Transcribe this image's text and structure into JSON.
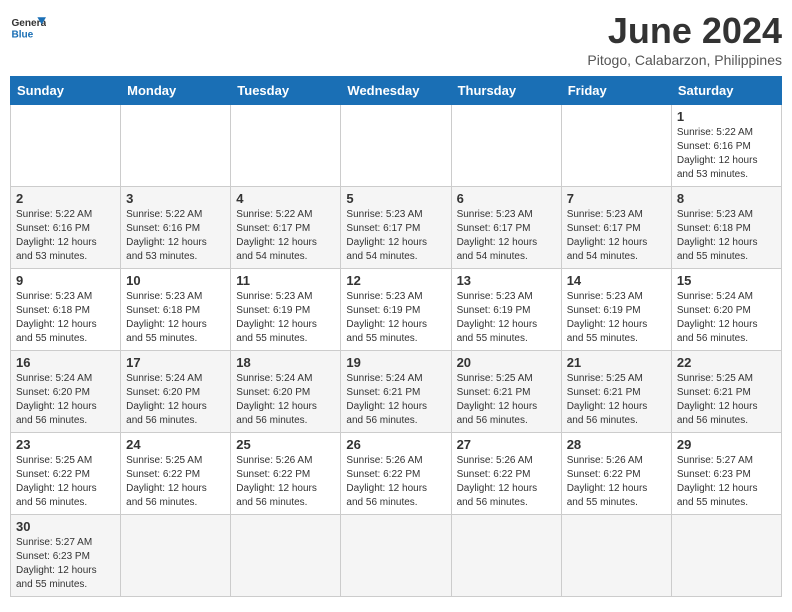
{
  "header": {
    "logo_text_general": "General",
    "logo_text_blue": "Blue",
    "month_title": "June 2024",
    "subtitle": "Pitogo, Calabarzon, Philippines"
  },
  "days_of_week": [
    "Sunday",
    "Monday",
    "Tuesday",
    "Wednesday",
    "Thursday",
    "Friday",
    "Saturday"
  ],
  "weeks": [
    {
      "shaded": false,
      "days": [
        {
          "number": "",
          "info": ""
        },
        {
          "number": "",
          "info": ""
        },
        {
          "number": "",
          "info": ""
        },
        {
          "number": "",
          "info": ""
        },
        {
          "number": "",
          "info": ""
        },
        {
          "number": "",
          "info": ""
        },
        {
          "number": "1",
          "info": "Sunrise: 5:22 AM\nSunset: 6:16 PM\nDaylight: 12 hours\nand 53 minutes."
        }
      ]
    },
    {
      "shaded": true,
      "days": [
        {
          "number": "2",
          "info": "Sunrise: 5:22 AM\nSunset: 6:16 PM\nDaylight: 12 hours\nand 53 minutes."
        },
        {
          "number": "3",
          "info": "Sunrise: 5:22 AM\nSunset: 6:16 PM\nDaylight: 12 hours\nand 53 minutes."
        },
        {
          "number": "4",
          "info": "Sunrise: 5:22 AM\nSunset: 6:17 PM\nDaylight: 12 hours\nand 54 minutes."
        },
        {
          "number": "5",
          "info": "Sunrise: 5:23 AM\nSunset: 6:17 PM\nDaylight: 12 hours\nand 54 minutes."
        },
        {
          "number": "6",
          "info": "Sunrise: 5:23 AM\nSunset: 6:17 PM\nDaylight: 12 hours\nand 54 minutes."
        },
        {
          "number": "7",
          "info": "Sunrise: 5:23 AM\nSunset: 6:17 PM\nDaylight: 12 hours\nand 54 minutes."
        },
        {
          "number": "8",
          "info": "Sunrise: 5:23 AM\nSunset: 6:18 PM\nDaylight: 12 hours\nand 55 minutes."
        }
      ]
    },
    {
      "shaded": false,
      "days": [
        {
          "number": "9",
          "info": "Sunrise: 5:23 AM\nSunset: 6:18 PM\nDaylight: 12 hours\nand 55 minutes."
        },
        {
          "number": "10",
          "info": "Sunrise: 5:23 AM\nSunset: 6:18 PM\nDaylight: 12 hours\nand 55 minutes."
        },
        {
          "number": "11",
          "info": "Sunrise: 5:23 AM\nSunset: 6:19 PM\nDaylight: 12 hours\nand 55 minutes."
        },
        {
          "number": "12",
          "info": "Sunrise: 5:23 AM\nSunset: 6:19 PM\nDaylight: 12 hours\nand 55 minutes."
        },
        {
          "number": "13",
          "info": "Sunrise: 5:23 AM\nSunset: 6:19 PM\nDaylight: 12 hours\nand 55 minutes."
        },
        {
          "number": "14",
          "info": "Sunrise: 5:23 AM\nSunset: 6:19 PM\nDaylight: 12 hours\nand 55 minutes."
        },
        {
          "number": "15",
          "info": "Sunrise: 5:24 AM\nSunset: 6:20 PM\nDaylight: 12 hours\nand 56 minutes."
        }
      ]
    },
    {
      "shaded": true,
      "days": [
        {
          "number": "16",
          "info": "Sunrise: 5:24 AM\nSunset: 6:20 PM\nDaylight: 12 hours\nand 56 minutes."
        },
        {
          "number": "17",
          "info": "Sunrise: 5:24 AM\nSunset: 6:20 PM\nDaylight: 12 hours\nand 56 minutes."
        },
        {
          "number": "18",
          "info": "Sunrise: 5:24 AM\nSunset: 6:20 PM\nDaylight: 12 hours\nand 56 minutes."
        },
        {
          "number": "19",
          "info": "Sunrise: 5:24 AM\nSunset: 6:21 PM\nDaylight: 12 hours\nand 56 minutes."
        },
        {
          "number": "20",
          "info": "Sunrise: 5:25 AM\nSunset: 6:21 PM\nDaylight: 12 hours\nand 56 minutes."
        },
        {
          "number": "21",
          "info": "Sunrise: 5:25 AM\nSunset: 6:21 PM\nDaylight: 12 hours\nand 56 minutes."
        },
        {
          "number": "22",
          "info": "Sunrise: 5:25 AM\nSunset: 6:21 PM\nDaylight: 12 hours\nand 56 minutes."
        }
      ]
    },
    {
      "shaded": false,
      "days": [
        {
          "number": "23",
          "info": "Sunrise: 5:25 AM\nSunset: 6:22 PM\nDaylight: 12 hours\nand 56 minutes."
        },
        {
          "number": "24",
          "info": "Sunrise: 5:25 AM\nSunset: 6:22 PM\nDaylight: 12 hours\nand 56 minutes."
        },
        {
          "number": "25",
          "info": "Sunrise: 5:26 AM\nSunset: 6:22 PM\nDaylight: 12 hours\nand 56 minutes."
        },
        {
          "number": "26",
          "info": "Sunrise: 5:26 AM\nSunset: 6:22 PM\nDaylight: 12 hours\nand 56 minutes."
        },
        {
          "number": "27",
          "info": "Sunrise: 5:26 AM\nSunset: 6:22 PM\nDaylight: 12 hours\nand 56 minutes."
        },
        {
          "number": "28",
          "info": "Sunrise: 5:26 AM\nSunset: 6:22 PM\nDaylight: 12 hours\nand 55 minutes."
        },
        {
          "number": "29",
          "info": "Sunrise: 5:27 AM\nSunset: 6:23 PM\nDaylight: 12 hours\nand 55 minutes."
        }
      ]
    },
    {
      "shaded": true,
      "days": [
        {
          "number": "30",
          "info": "Sunrise: 5:27 AM\nSunset: 6:23 PM\nDaylight: 12 hours\nand 55 minutes."
        },
        {
          "number": "",
          "info": ""
        },
        {
          "number": "",
          "info": ""
        },
        {
          "number": "",
          "info": ""
        },
        {
          "number": "",
          "info": ""
        },
        {
          "number": "",
          "info": ""
        },
        {
          "number": "",
          "info": ""
        }
      ]
    }
  ]
}
